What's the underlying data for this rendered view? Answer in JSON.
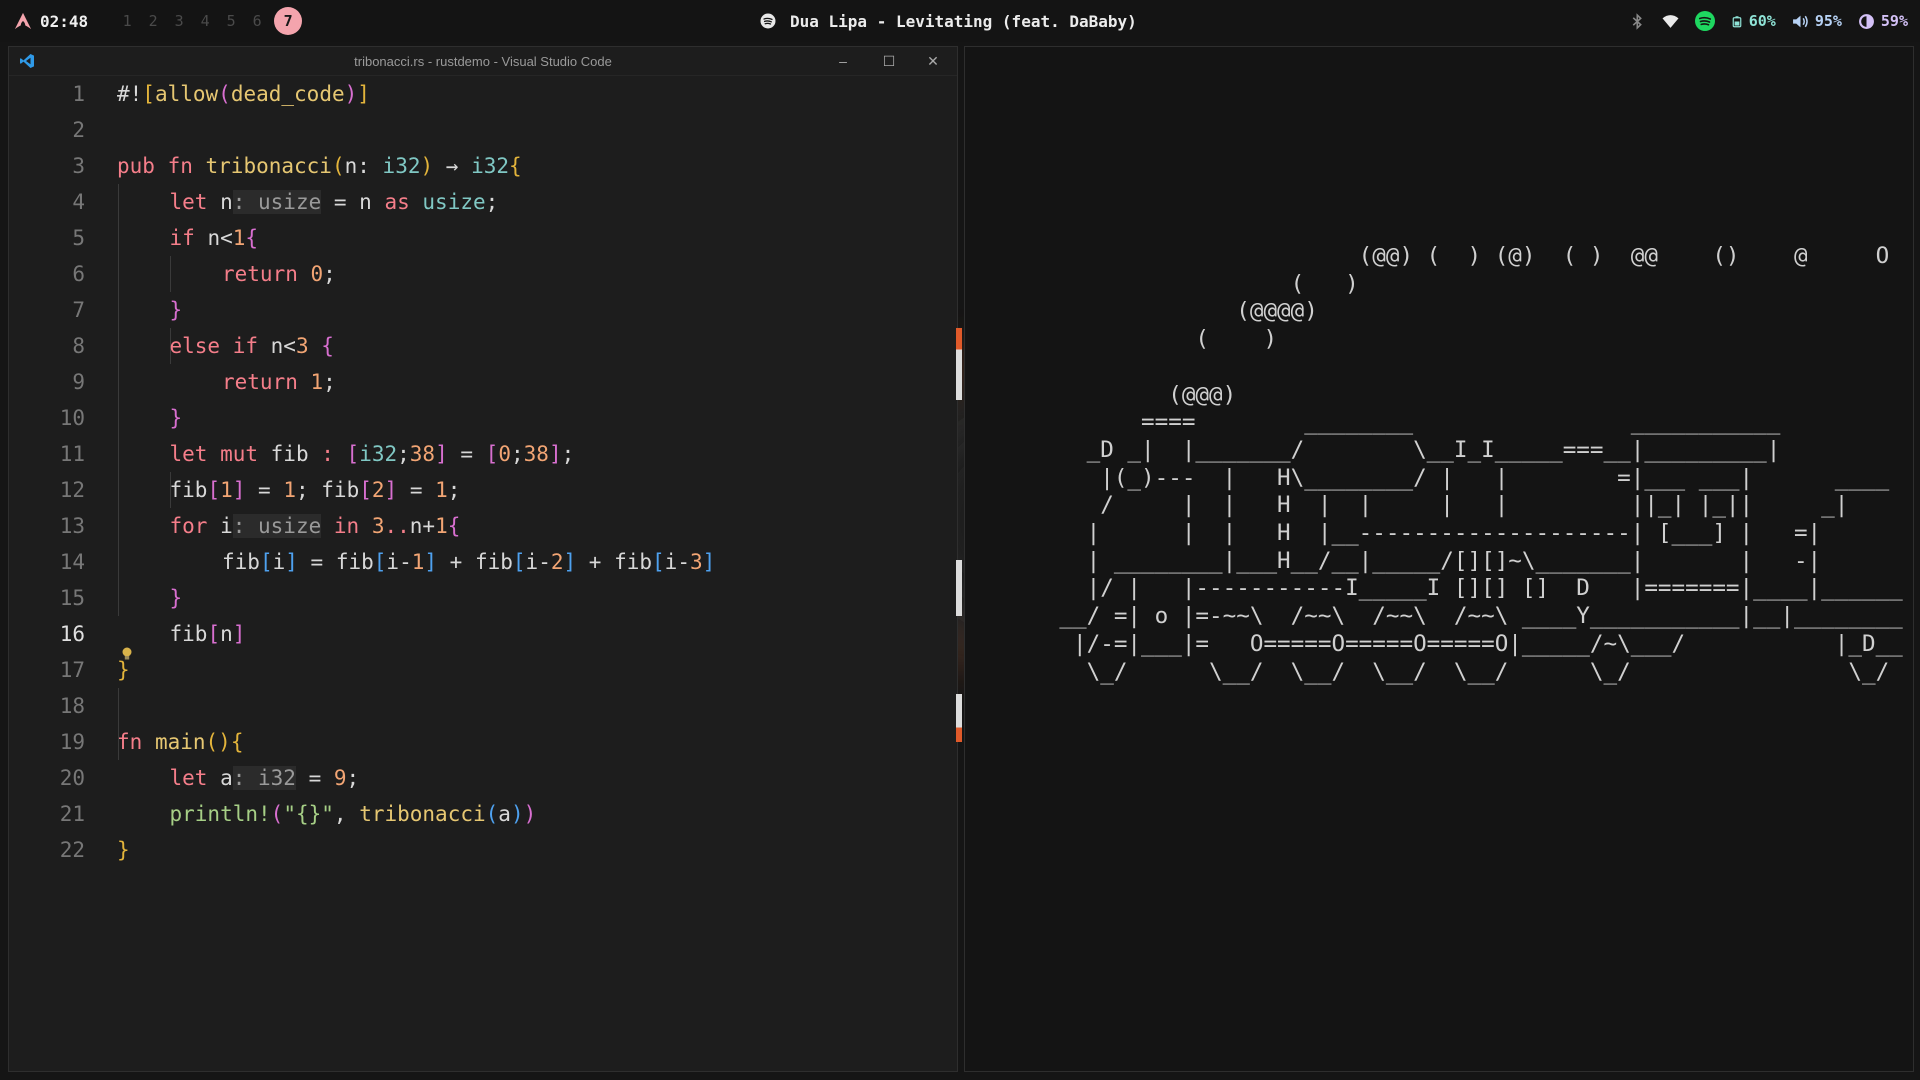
{
  "topbar": {
    "clock": "02:48",
    "workspaces": [
      "1",
      "2",
      "3",
      "4",
      "5",
      "6",
      "7"
    ],
    "active_workspace": "7",
    "now_playing": "Dua Lipa - Levitating (feat. DaBaby)",
    "battery": "60%",
    "volume": "95%",
    "brightness": "59%",
    "colors": {
      "accent": "#f4a4ad",
      "spotify": "#1ed760"
    }
  },
  "vscode": {
    "title": "tribonacci.rs - rustdemo - Visual Studio Code",
    "current_line": 16,
    "lines": [
      {
        "n": "1",
        "indent": 0,
        "tokens": [
          [
            "op",
            "#!"
          ],
          [
            "p1",
            "["
          ],
          [
            "fn",
            "allow"
          ],
          [
            "p2",
            "("
          ],
          [
            "fn",
            "dead_code"
          ],
          [
            "p2",
            ")"
          ],
          [
            "p1",
            "]"
          ]
        ]
      },
      {
        "n": "2",
        "indent": 0,
        "tokens": []
      },
      {
        "n": "3",
        "indent": 0,
        "tokens": [
          [
            "kw",
            "pub fn "
          ],
          [
            "fn",
            "tribonacci"
          ],
          [
            "p1",
            "("
          ],
          [
            "op",
            "n: "
          ],
          [
            "ty",
            "i32"
          ],
          [
            "p1",
            ")"
          ],
          [
            "op",
            " → "
          ],
          [
            "ty",
            "i32"
          ],
          [
            "p1",
            "{"
          ]
        ]
      },
      {
        "n": "4",
        "indent": 1,
        "tokens": [
          [
            "kw",
            "let "
          ],
          [
            "op",
            "n"
          ],
          [
            "hint",
            ": usize"
          ],
          [
            "op",
            " = n "
          ],
          [
            "kw",
            "as "
          ],
          [
            "ty",
            "usize"
          ],
          [
            "op",
            ";"
          ]
        ]
      },
      {
        "n": "5",
        "indent": 1,
        "tokens": [
          [
            "kw",
            "if "
          ],
          [
            "op",
            "n<"
          ],
          [
            "nm",
            "1"
          ],
          [
            "p2",
            "{"
          ]
        ]
      },
      {
        "n": "6",
        "indent": 2,
        "tokens": [
          [
            "kw",
            "return "
          ],
          [
            "nm",
            "0"
          ],
          [
            "op",
            ";"
          ]
        ]
      },
      {
        "n": "7",
        "indent": 1,
        "tokens": [
          [
            "p2",
            "}"
          ]
        ]
      },
      {
        "n": "8",
        "indent": 1,
        "tokens": [
          [
            "kw",
            "else if "
          ],
          [
            "op",
            "n<"
          ],
          [
            "nm",
            "3 "
          ],
          [
            "p2",
            "{"
          ]
        ]
      },
      {
        "n": "9",
        "indent": 2,
        "tokens": [
          [
            "kw",
            "return "
          ],
          [
            "nm",
            "1"
          ],
          [
            "op",
            ";"
          ]
        ]
      },
      {
        "n": "10",
        "indent": 1,
        "tokens": [
          [
            "p2",
            "}"
          ]
        ]
      },
      {
        "n": "11",
        "indent": 1,
        "tokens": [
          [
            "kw",
            "let mut "
          ],
          [
            "op",
            "fib "
          ],
          [
            "kw",
            ": "
          ],
          [
            "p2",
            "["
          ],
          [
            "ty",
            "i32"
          ],
          [
            "op",
            ";"
          ],
          [
            "nm",
            "38"
          ],
          [
            "p2",
            "]"
          ],
          [
            "op",
            " = "
          ],
          [
            "p2",
            "["
          ],
          [
            "nm",
            "0"
          ],
          [
            "op",
            ";"
          ],
          [
            "nm",
            "38"
          ],
          [
            "p2",
            "]"
          ],
          [
            "op",
            ";"
          ]
        ]
      },
      {
        "n": "12",
        "indent": 1,
        "tokens": [
          [
            "op",
            "fib"
          ],
          [
            "p2",
            "["
          ],
          [
            "nm",
            "1"
          ],
          [
            "p2",
            "]"
          ],
          [
            "op",
            " = "
          ],
          [
            "nm",
            "1"
          ],
          [
            "op",
            "; fib"
          ],
          [
            "p2",
            "["
          ],
          [
            "nm",
            "2"
          ],
          [
            "p2",
            "]"
          ],
          [
            "op",
            " = "
          ],
          [
            "nm",
            "1"
          ],
          [
            "op",
            ";"
          ]
        ]
      },
      {
        "n": "13",
        "indent": 1,
        "tokens": [
          [
            "kw",
            "for "
          ],
          [
            "op",
            "i"
          ],
          [
            "hint",
            ": usize"
          ],
          [
            "kw",
            " in "
          ],
          [
            "nm",
            "3"
          ],
          [
            "kw",
            ".."
          ],
          [
            "op",
            "n+"
          ],
          [
            "nm",
            "1"
          ],
          [
            "p2",
            "{"
          ]
        ]
      },
      {
        "n": "14",
        "indent": 2,
        "tokens": [
          [
            "op",
            "fib"
          ],
          [
            "p3",
            "["
          ],
          [
            "op",
            "i"
          ],
          [
            "p3",
            "]"
          ],
          [
            "op",
            " = fib"
          ],
          [
            "p3",
            "["
          ],
          [
            "op",
            "i-"
          ],
          [
            "nm",
            "1"
          ],
          [
            "p3",
            "]"
          ],
          [
            "op",
            " + fib"
          ],
          [
            "p3",
            "["
          ],
          [
            "op",
            "i-"
          ],
          [
            "nm",
            "2"
          ],
          [
            "p3",
            "]"
          ],
          [
            "op",
            " + fib"
          ],
          [
            "p3",
            "["
          ],
          [
            "op",
            "i-"
          ],
          [
            "nm",
            "3"
          ],
          [
            "p3",
            "]"
          ]
        ]
      },
      {
        "n": "15",
        "indent": 1,
        "tokens": [
          [
            "p2",
            "}"
          ]
        ]
      },
      {
        "n": "16",
        "indent": 1,
        "tokens": [
          [
            "op",
            "fib"
          ],
          [
            "p2",
            "["
          ],
          [
            "op",
            "n"
          ],
          [
            "p2",
            "]"
          ]
        ]
      },
      {
        "n": "17",
        "indent": 0,
        "tokens": [
          [
            "p1",
            "}"
          ]
        ]
      },
      {
        "n": "18",
        "indent": 0,
        "tokens": []
      },
      {
        "n": "19",
        "indent": 0,
        "tokens": [
          [
            "kw",
            "fn "
          ],
          [
            "fn",
            "main"
          ],
          [
            "p1",
            "()"
          ],
          [
            "p1",
            "{"
          ]
        ]
      },
      {
        "n": "20",
        "indent": 1,
        "tokens": [
          [
            "kw",
            "let "
          ],
          [
            "op",
            "a"
          ],
          [
            "hint",
            ": i32"
          ],
          [
            "op",
            " = "
          ],
          [
            "nm",
            "9"
          ],
          [
            "op",
            ";"
          ]
        ]
      },
      {
        "n": "21",
        "indent": 1,
        "tokens": [
          [
            "mac",
            "println!"
          ],
          [
            "p2",
            "("
          ],
          [
            "st",
            "\"{}\""
          ],
          [
            "op",
            ", "
          ],
          [
            "fn",
            "tribonacci"
          ],
          [
            "p3",
            "("
          ],
          [
            "op",
            "a"
          ],
          [
            "p3",
            ")"
          ],
          [
            "p2",
            ")"
          ]
        ]
      },
      {
        "n": "22",
        "indent": 0,
        "tokens": [
          [
            "p1",
            "}"
          ]
        ]
      }
    ]
  },
  "terminal": {
    "ascii_art": [
      "                          (@@) (  ) (@)  ( )  @@    ()    @     O     @",
      "                     (   )",
      "                 (@@@@)",
      "              (    )",
      "",
      "            (@@@)",
      "          ====        ________                ___________",
      "      _D _|  |_______/        \\__I_I_____===__|_________|",
      "       |(_)---  |   H\\________/ |   |        =|___ ___|      ____",
      "       /     |  |   H  |  |     |   |         ||_| |_||     _|",
      "      |      |  |   H  |__--------------------| [___] |   =|",
      "      | ________|___H__/__|_____/[][]~\\_______|       |   -|",
      "      |/ |   |-----------I_____I [][] []  D   |=======|____|______",
      "    __/ =| o |=-~~\\  /~~\\  /~~\\  /~~\\ ____Y___________|__|________",
      "     |/-=|___|=   O=====O=====O=====O|_____/~\\___/           |_D__",
      "      \\_/      \\__/  \\__/  \\__/  \\__/      \\_/                \\_/"
    ]
  }
}
